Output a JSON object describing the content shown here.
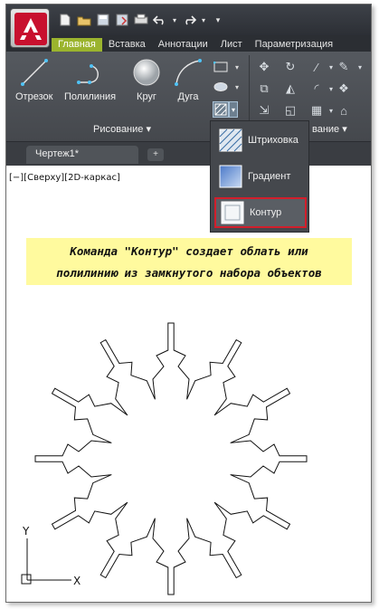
{
  "tabs": [
    {
      "label": "Главная",
      "active": true
    },
    {
      "label": "Вставка"
    },
    {
      "label": "Аннотации"
    },
    {
      "label": "Лист"
    },
    {
      "label": "Параметризация"
    }
  ],
  "draw_tools": [
    {
      "label": "Отрезок",
      "icon": "line-icon"
    },
    {
      "label": "Полилиния",
      "icon": "polyline-icon"
    },
    {
      "label": "Круг",
      "icon": "circle-icon"
    },
    {
      "label": "Дуга",
      "icon": "arc-icon"
    }
  ],
  "panels": {
    "draw_title": "Рисование ▾",
    "modify_title": "вание ▾"
  },
  "dropdown": {
    "items": [
      {
        "label": "Штриховка",
        "icon": "hatch-icon"
      },
      {
        "label": "Градиент",
        "icon": "gradient-icon"
      },
      {
        "label": "Контур",
        "icon": "boundary-icon",
        "selected": true
      }
    ]
  },
  "document": {
    "tab_label": "Чертеж1*",
    "add_tab": "+"
  },
  "viewport_label": "[−][Сверху][2D-каркас]",
  "caption": {
    "line1": "Команда \"Контур\" создает облать или",
    "line2": "полилинию из замкнутого набора объектов"
  },
  "ucs": {
    "x_label": "X",
    "y_label": "Y"
  },
  "colors": {
    "ribbon": "#4d5156",
    "active_tab": "#9bb42e",
    "caption_bg": "#fffa9e",
    "highlight": "#d21e2b"
  }
}
